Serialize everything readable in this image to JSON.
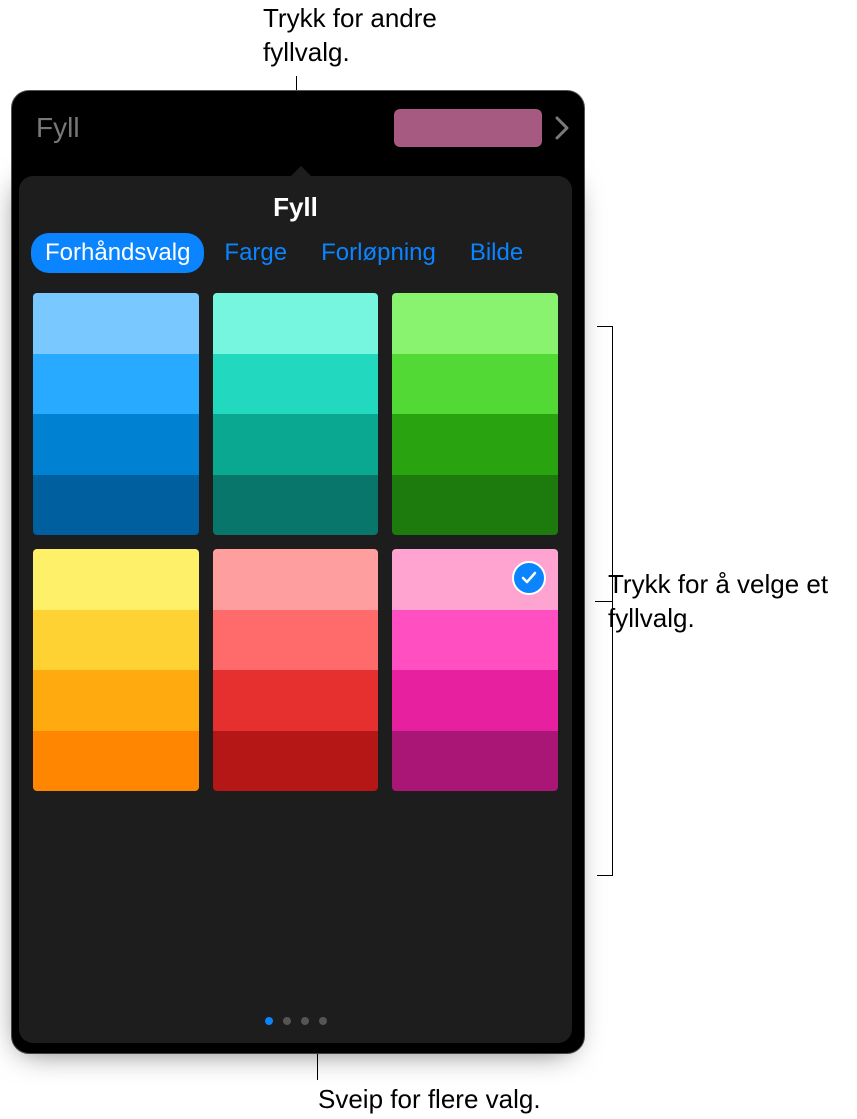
{
  "callouts": {
    "top": "Trykk for andre fyllvalg.",
    "right": "Trykk for å velge et fyllvalg.",
    "bottom": "Sveip for flere valg."
  },
  "header": {
    "label": "Fyll",
    "current_color": "#a65a82",
    "chevron_icon": "chevron-right"
  },
  "popover": {
    "title": "Fyll",
    "tabs": [
      {
        "label": "Forhåndsvalg",
        "active": true
      },
      {
        "label": "Farge",
        "active": false
      },
      {
        "label": "Forløpning",
        "active": false
      },
      {
        "label": "Bilde",
        "active": false
      }
    ],
    "presets": [
      {
        "name": "blue",
        "colors": [
          "#79c8ff",
          "#27aaff",
          "#0081d1",
          "#005f9e"
        ],
        "selected": false
      },
      {
        "name": "teal",
        "colors": [
          "#76f5df",
          "#22d9c0",
          "#0aa890",
          "#08766a"
        ],
        "selected": false
      },
      {
        "name": "green",
        "colors": [
          "#89f26e",
          "#52d935",
          "#2aa311",
          "#1d7a0c"
        ],
        "selected": false
      },
      {
        "name": "yellow",
        "colors": [
          "#fff06a",
          "#ffd233",
          "#ffaa0f",
          "#ff8600"
        ],
        "selected": false
      },
      {
        "name": "red",
        "colors": [
          "#ff9e9e",
          "#ff6a6a",
          "#e63030",
          "#b51616"
        ],
        "selected": false
      },
      {
        "name": "pink",
        "colors": [
          "#ffa3d1",
          "#ff4fc0",
          "#e6209f",
          "#a91676"
        ],
        "selected": true
      }
    ],
    "page_count": 4,
    "active_page": 0,
    "checkmark_icon": "checkmark"
  }
}
